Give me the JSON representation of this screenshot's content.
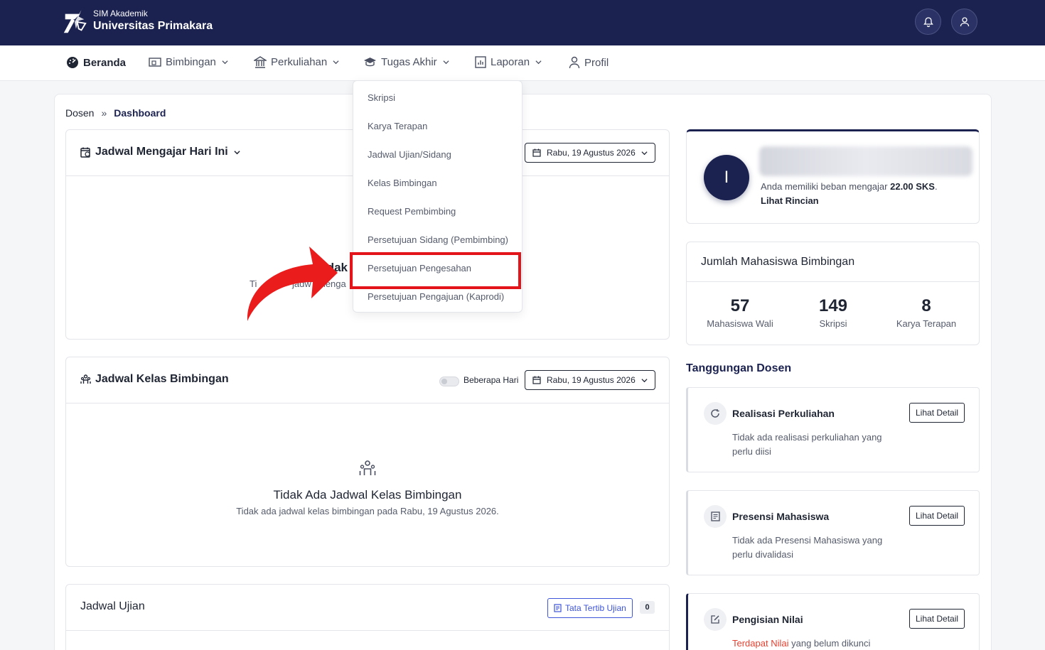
{
  "header": {
    "brand_sub": "SIM Akademik",
    "brand_main": "Universitas Primakara",
    "icons": [
      "bell-icon",
      "user-icon"
    ]
  },
  "nav": {
    "items": [
      {
        "label": "Beranda",
        "icon": "dashboard-icon"
      },
      {
        "label": "Bimbingan",
        "icon": "guidance-icon"
      },
      {
        "label": "Perkuliahan",
        "icon": "institution-icon"
      },
      {
        "label": "Tugas Akhir",
        "icon": "graduation-icon"
      },
      {
        "label": "Laporan",
        "icon": "report-icon"
      },
      {
        "label": "Profil",
        "icon": "profile-icon"
      }
    ]
  },
  "breadcrumb": {
    "root": "Dosen",
    "separator": "»",
    "current": "Dashboard"
  },
  "dropdown": {
    "items": [
      "Skripsi",
      "Karya Terapan",
      "Jadwal Ujian/Sidang",
      "Kelas Bimbingan",
      "Request Pembimbing",
      "Persetujuan Sidang (Pembimbing)",
      "Persetujuan Pengesahan",
      "Persetujuan Pengajuan (Kaprodi)"
    ],
    "highlighted": "Persetujuan Pengesahan"
  },
  "jadwal_mengajar": {
    "title": "Jadwal Mengajar Hari Ini",
    "date": "Rabu, 19 Agustus 2026",
    "visible_title_fragment": "idak",
    "visible_sub_fragment_1": "Ti",
    "visible_sub_fragment_2": "jadw",
    "visible_sub_fragment_3": "menga"
  },
  "jadwal_bimbingan": {
    "title": "Jadwal Kelas Bimbingan",
    "toggle_label": "Beberapa Hari",
    "date": "Rabu, 19 Agustus 2026",
    "empty_title": "Tidak Ada Jadwal Kelas Bimbingan",
    "empty_sub": "Tidak ada jadwal kelas bimbingan pada Rabu, 19 Agustus 2026."
  },
  "jadwal_ujian": {
    "title": "Jadwal Ujian",
    "rules_button": "Tata Tertib Ujian",
    "count": "0"
  },
  "profile": {
    "avatar_initial": "I",
    "load_prefix": "Anda memiliki beban mengajar ",
    "load_value": "22.00 SKS",
    "load_suffix": ".",
    "detail_link": "Lihat Rincian"
  },
  "jumlah_mahasiswa": {
    "title": "Jumlah Mahasiswa Bimbingan",
    "stats": [
      {
        "value": "57",
        "label": "Mahasiswa Wali"
      },
      {
        "value": "149",
        "label": "Skripsi"
      },
      {
        "value": "8",
        "label": "Karya Terapan"
      }
    ]
  },
  "tanggungan": {
    "heading": "Tanggungan Dosen",
    "detail_label": "Lihat Detail",
    "items": [
      {
        "title": "Realisasi Perkuliahan",
        "desc": "Tidak ada realisasi perkuliahan yang perlu diisi",
        "icon": "refresh-icon"
      },
      {
        "title": "Presensi Mahasiswa",
        "desc": "Tidak ada Presensi Mahasiswa yang perlu divalidasi",
        "icon": "document-list-icon"
      },
      {
        "title": "Pengisian Nilai",
        "desc_highlight": "Terdapat Nilai",
        "desc_rest": " yang belum dikunci",
        "icon": "edit-icon"
      }
    ]
  },
  "colors": {
    "primary": "#1b2250",
    "highlight": "#e3151a",
    "arrow": "#ea1c1c",
    "link_blue": "#3e54d9",
    "warning_text": "#e8402f"
  }
}
